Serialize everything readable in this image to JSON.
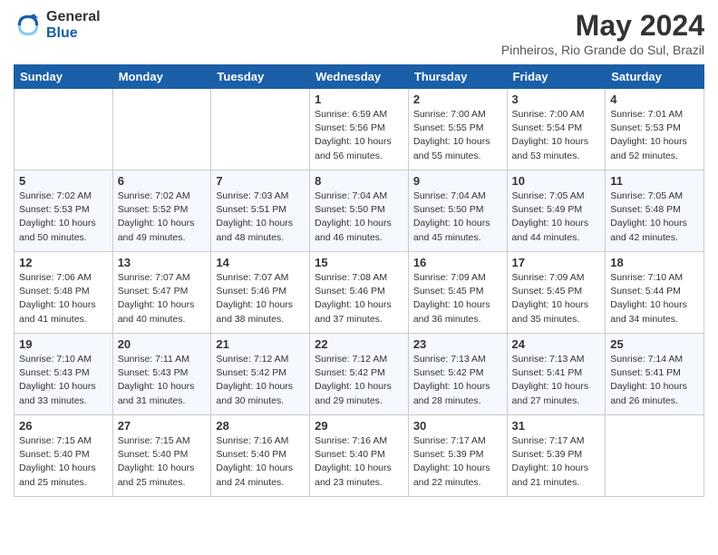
{
  "header": {
    "logo_general": "General",
    "logo_blue": "Blue",
    "main_title": "May 2024",
    "subtitle": "Pinheiros, Rio Grande do Sul, Brazil"
  },
  "days_of_week": [
    "Sunday",
    "Monday",
    "Tuesday",
    "Wednesday",
    "Thursday",
    "Friday",
    "Saturday"
  ],
  "weeks": [
    [
      {
        "day": "",
        "info": ""
      },
      {
        "day": "",
        "info": ""
      },
      {
        "day": "",
        "info": ""
      },
      {
        "day": "1",
        "info": "Sunrise: 6:59 AM\nSunset: 5:56 PM\nDaylight: 10 hours\nand 56 minutes."
      },
      {
        "day": "2",
        "info": "Sunrise: 7:00 AM\nSunset: 5:55 PM\nDaylight: 10 hours\nand 55 minutes."
      },
      {
        "day": "3",
        "info": "Sunrise: 7:00 AM\nSunset: 5:54 PM\nDaylight: 10 hours\nand 53 minutes."
      },
      {
        "day": "4",
        "info": "Sunrise: 7:01 AM\nSunset: 5:53 PM\nDaylight: 10 hours\nand 52 minutes."
      }
    ],
    [
      {
        "day": "5",
        "info": "Sunrise: 7:02 AM\nSunset: 5:53 PM\nDaylight: 10 hours\nand 50 minutes."
      },
      {
        "day": "6",
        "info": "Sunrise: 7:02 AM\nSunset: 5:52 PM\nDaylight: 10 hours\nand 49 minutes."
      },
      {
        "day": "7",
        "info": "Sunrise: 7:03 AM\nSunset: 5:51 PM\nDaylight: 10 hours\nand 48 minutes."
      },
      {
        "day": "8",
        "info": "Sunrise: 7:04 AM\nSunset: 5:50 PM\nDaylight: 10 hours\nand 46 minutes."
      },
      {
        "day": "9",
        "info": "Sunrise: 7:04 AM\nSunset: 5:50 PM\nDaylight: 10 hours\nand 45 minutes."
      },
      {
        "day": "10",
        "info": "Sunrise: 7:05 AM\nSunset: 5:49 PM\nDaylight: 10 hours\nand 44 minutes."
      },
      {
        "day": "11",
        "info": "Sunrise: 7:05 AM\nSunset: 5:48 PM\nDaylight: 10 hours\nand 42 minutes."
      }
    ],
    [
      {
        "day": "12",
        "info": "Sunrise: 7:06 AM\nSunset: 5:48 PM\nDaylight: 10 hours\nand 41 minutes."
      },
      {
        "day": "13",
        "info": "Sunrise: 7:07 AM\nSunset: 5:47 PM\nDaylight: 10 hours\nand 40 minutes."
      },
      {
        "day": "14",
        "info": "Sunrise: 7:07 AM\nSunset: 5:46 PM\nDaylight: 10 hours\nand 38 minutes."
      },
      {
        "day": "15",
        "info": "Sunrise: 7:08 AM\nSunset: 5:46 PM\nDaylight: 10 hours\nand 37 minutes."
      },
      {
        "day": "16",
        "info": "Sunrise: 7:09 AM\nSunset: 5:45 PM\nDaylight: 10 hours\nand 36 minutes."
      },
      {
        "day": "17",
        "info": "Sunrise: 7:09 AM\nSunset: 5:45 PM\nDaylight: 10 hours\nand 35 minutes."
      },
      {
        "day": "18",
        "info": "Sunrise: 7:10 AM\nSunset: 5:44 PM\nDaylight: 10 hours\nand 34 minutes."
      }
    ],
    [
      {
        "day": "19",
        "info": "Sunrise: 7:10 AM\nSunset: 5:43 PM\nDaylight: 10 hours\nand 33 minutes."
      },
      {
        "day": "20",
        "info": "Sunrise: 7:11 AM\nSunset: 5:43 PM\nDaylight: 10 hours\nand 31 minutes."
      },
      {
        "day": "21",
        "info": "Sunrise: 7:12 AM\nSunset: 5:42 PM\nDaylight: 10 hours\nand 30 minutes."
      },
      {
        "day": "22",
        "info": "Sunrise: 7:12 AM\nSunset: 5:42 PM\nDaylight: 10 hours\nand 29 minutes."
      },
      {
        "day": "23",
        "info": "Sunrise: 7:13 AM\nSunset: 5:42 PM\nDaylight: 10 hours\nand 28 minutes."
      },
      {
        "day": "24",
        "info": "Sunrise: 7:13 AM\nSunset: 5:41 PM\nDaylight: 10 hours\nand 27 minutes."
      },
      {
        "day": "25",
        "info": "Sunrise: 7:14 AM\nSunset: 5:41 PM\nDaylight: 10 hours\nand 26 minutes."
      }
    ],
    [
      {
        "day": "26",
        "info": "Sunrise: 7:15 AM\nSunset: 5:40 PM\nDaylight: 10 hours\nand 25 minutes."
      },
      {
        "day": "27",
        "info": "Sunrise: 7:15 AM\nSunset: 5:40 PM\nDaylight: 10 hours\nand 25 minutes."
      },
      {
        "day": "28",
        "info": "Sunrise: 7:16 AM\nSunset: 5:40 PM\nDaylight: 10 hours\nand 24 minutes."
      },
      {
        "day": "29",
        "info": "Sunrise: 7:16 AM\nSunset: 5:40 PM\nDaylight: 10 hours\nand 23 minutes."
      },
      {
        "day": "30",
        "info": "Sunrise: 7:17 AM\nSunset: 5:39 PM\nDaylight: 10 hours\nand 22 minutes."
      },
      {
        "day": "31",
        "info": "Sunrise: 7:17 AM\nSunset: 5:39 PM\nDaylight: 10 hours\nand 21 minutes."
      },
      {
        "day": "",
        "info": ""
      }
    ]
  ]
}
